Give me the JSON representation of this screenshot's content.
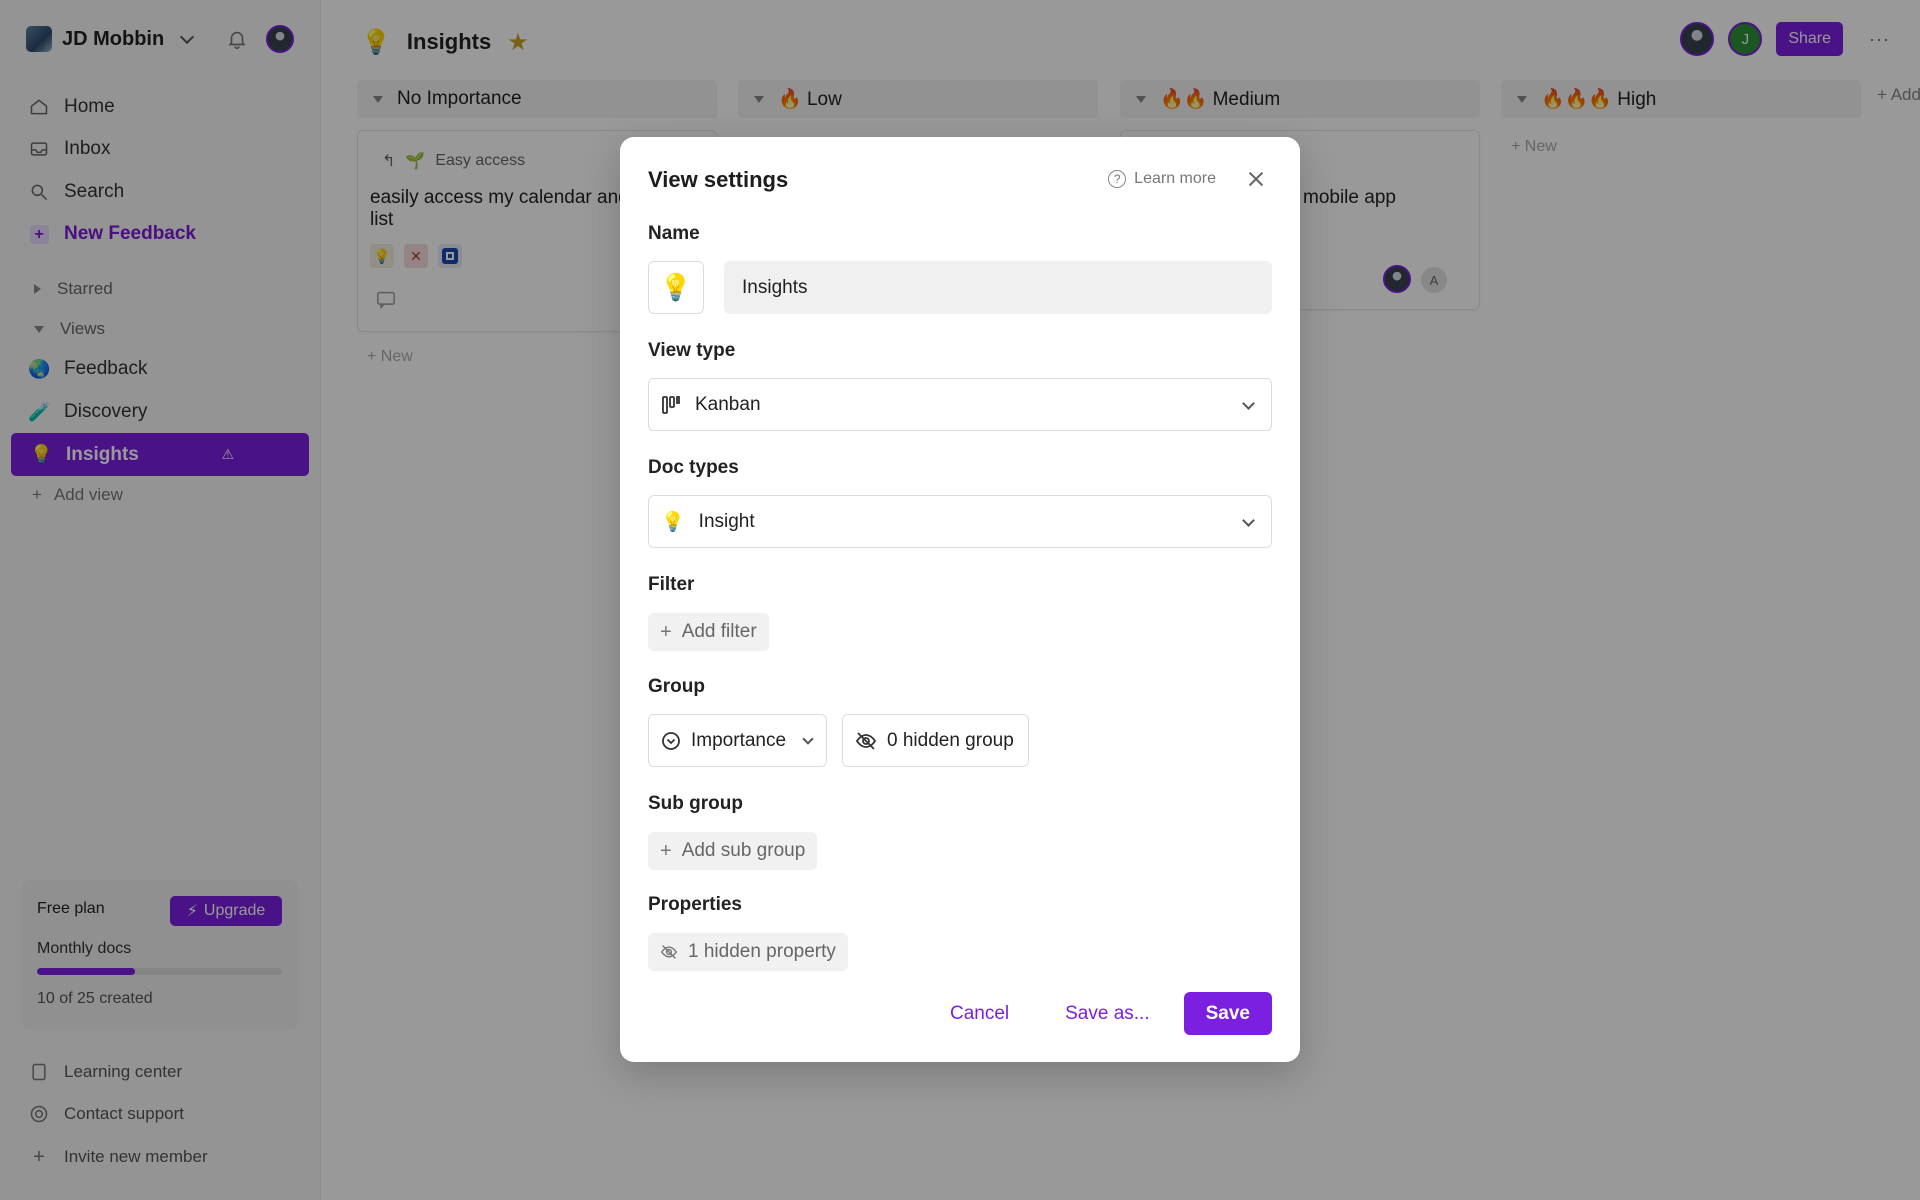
{
  "workspace": {
    "name": "JD Mobbin"
  },
  "sidebar": {
    "nav": [
      {
        "label": "Home",
        "icon": "home-icon"
      },
      {
        "label": "Inbox",
        "icon": "inbox-icon"
      },
      {
        "label": "Search",
        "icon": "search-icon"
      }
    ],
    "new_feedback": "New Feedback",
    "starred": "Starred",
    "views_label": "Views",
    "views": [
      {
        "label": "Feedback",
        "emoji": "🌏"
      },
      {
        "label": "Discovery",
        "emoji": "🧪"
      }
    ],
    "active_view": {
      "label": "Insights",
      "emoji": "💡",
      "warning": "⚠"
    },
    "add_view": "Add view",
    "plan": {
      "title": "Free plan",
      "upgrade": "Upgrade",
      "monthly": "Monthly docs",
      "used": 10,
      "total": 25,
      "created_text": "10 of 25 created"
    },
    "footer": [
      {
        "label": "Learning center",
        "icon": "book-icon"
      },
      {
        "label": "Contact support",
        "icon": "support-icon"
      },
      {
        "label": "Invite new member",
        "icon": "plus-icon"
      }
    ]
  },
  "page": {
    "emoji": "💡",
    "title": "Insights",
    "share": "Share",
    "avatar2_initial": "J",
    "more": "···"
  },
  "board": {
    "columns": [
      {
        "label": "No Importance",
        "prefix": ""
      },
      {
        "label": "Low",
        "prefix": "🔥"
      },
      {
        "label": "Medium",
        "prefix": "🔥🔥"
      },
      {
        "label": "High",
        "prefix": "🔥🔥🔥"
      }
    ],
    "new_label": "+ New",
    "add_col": "+ Add",
    "card1": {
      "parent_arrow": "↰",
      "parent_emoji": "🌱",
      "parent": "Easy access",
      "text": "easily access my calendar and list"
    },
    "card2": {
      "text": "mobile app",
      "avatar_initial": "A"
    }
  },
  "modal": {
    "title": "View settings",
    "learn_more": "Learn more",
    "name_label": "Name",
    "name_emoji": "💡",
    "name_value": "Insights",
    "view_type_label": "View type",
    "view_type_value": "Kanban",
    "doc_types_label": "Doc types",
    "doc_type_emoji": "💡",
    "doc_type_value": "Insight",
    "filter_label": "Filter",
    "add_filter": "Add filter",
    "group_label": "Group",
    "group_value": "Importance",
    "hidden_group": "0 hidden group",
    "sub_group_label": "Sub group",
    "add_sub_group": "Add sub group",
    "properties_label": "Properties",
    "hidden_property": "1 hidden property",
    "cancel": "Cancel",
    "save_as": "Save as...",
    "save": "Save"
  },
  "colors": {
    "accent": "#7b1fe0"
  }
}
